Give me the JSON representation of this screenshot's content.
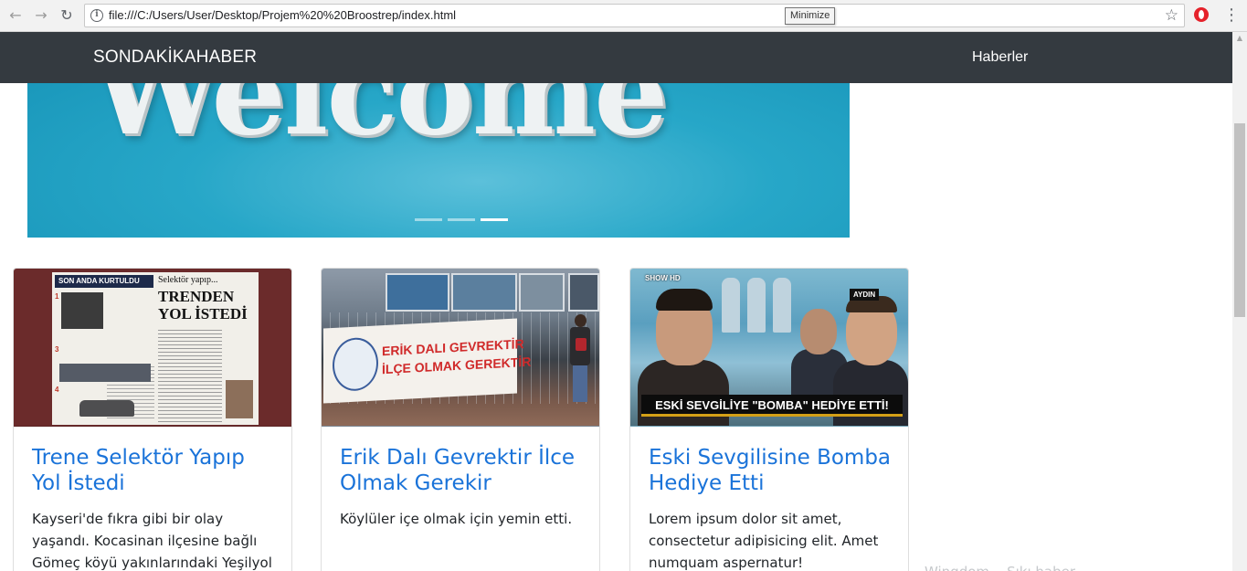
{
  "browser": {
    "url": "file:///C:/Users/User/Desktop/Projem%20%20Broostrep/index.html",
    "tooltip": "Minimize"
  },
  "navbar": {
    "brand": "SONDAKİKAHABER",
    "link": "Haberler"
  },
  "carousel": {
    "slide_text": "Welcome",
    "indicator_count": 3,
    "active_indicator": 3
  },
  "cards": [
    {
      "title": "Trene Selektör Yapıp Yol İstedi",
      "text": "Kayseri'de fıkra gibi bir olay yaşandı. Kocasinan ilçesine bağlı Gömeç köyü yakınlarındaki Yeşilyol Gazinosuna",
      "image": {
        "tag": "SON ANDA KURTULDU",
        "small": "Selektör yapıp...",
        "headline": "TRENDEN YOL İSTEDİ"
      }
    },
    {
      "title": "Erik Dalı Gevrektir İlce Olmak Gerekir",
      "text": "Köylüler içe olmak için yemin etti.",
      "image": {
        "banner_line1": "ERİK DALI GEVREKTİR",
        "banner_line2": "İLÇE OLMAK GEREKTİR"
      }
    },
    {
      "title": "Eski Sevgilisine Bomba Hediye Etti",
      "text": "Lorem ipsum dolor sit amet, consectetur adipisicing elit. Amet numquam aspernatur!",
      "image": {
        "channel": "SHOW HD",
        "location": "AYDIN",
        "caption": "ESKİ SEVGİLİYE \"BOMBA\" HEDİYE ETTİ!"
      }
    }
  ],
  "sidebar_faint_text": "Wingdom... Sıkı haber..."
}
